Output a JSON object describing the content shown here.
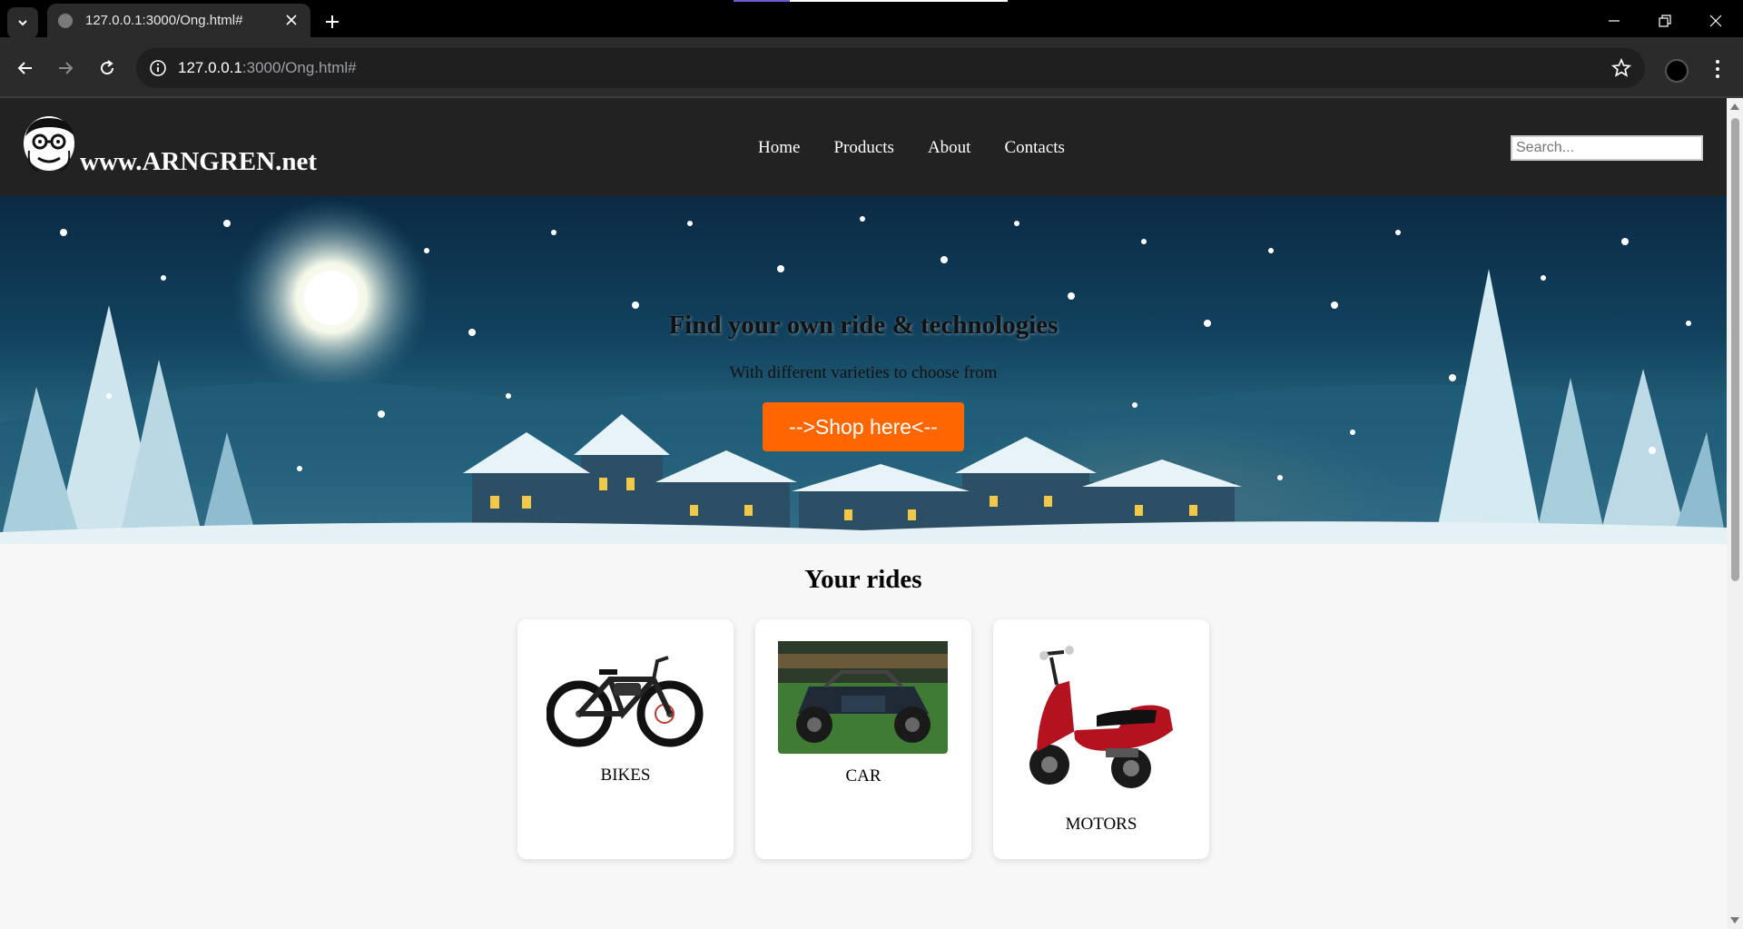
{
  "browser": {
    "tab_title": "127.0.0.1:3000/Ong.html#",
    "url_host": "127.0.0.1",
    "url_rest": ":3000/Ong.html#"
  },
  "site": {
    "logo_text": "www.ARNGREN.net",
    "nav": [
      "Home",
      "Products",
      "About",
      "Contacts"
    ],
    "search_placeholder": "Search..."
  },
  "hero": {
    "title": "Find your own ride & technologies",
    "subtitle": "With different varieties to choose from",
    "button": "-->Shop here<--"
  },
  "rides": {
    "title": "Your rides",
    "cards": [
      {
        "label": "BIKES"
      },
      {
        "label": "CAR"
      },
      {
        "label": "MOTORS"
      }
    ]
  },
  "colors": {
    "accent": "#ff6600",
    "header_bg": "#222222"
  }
}
